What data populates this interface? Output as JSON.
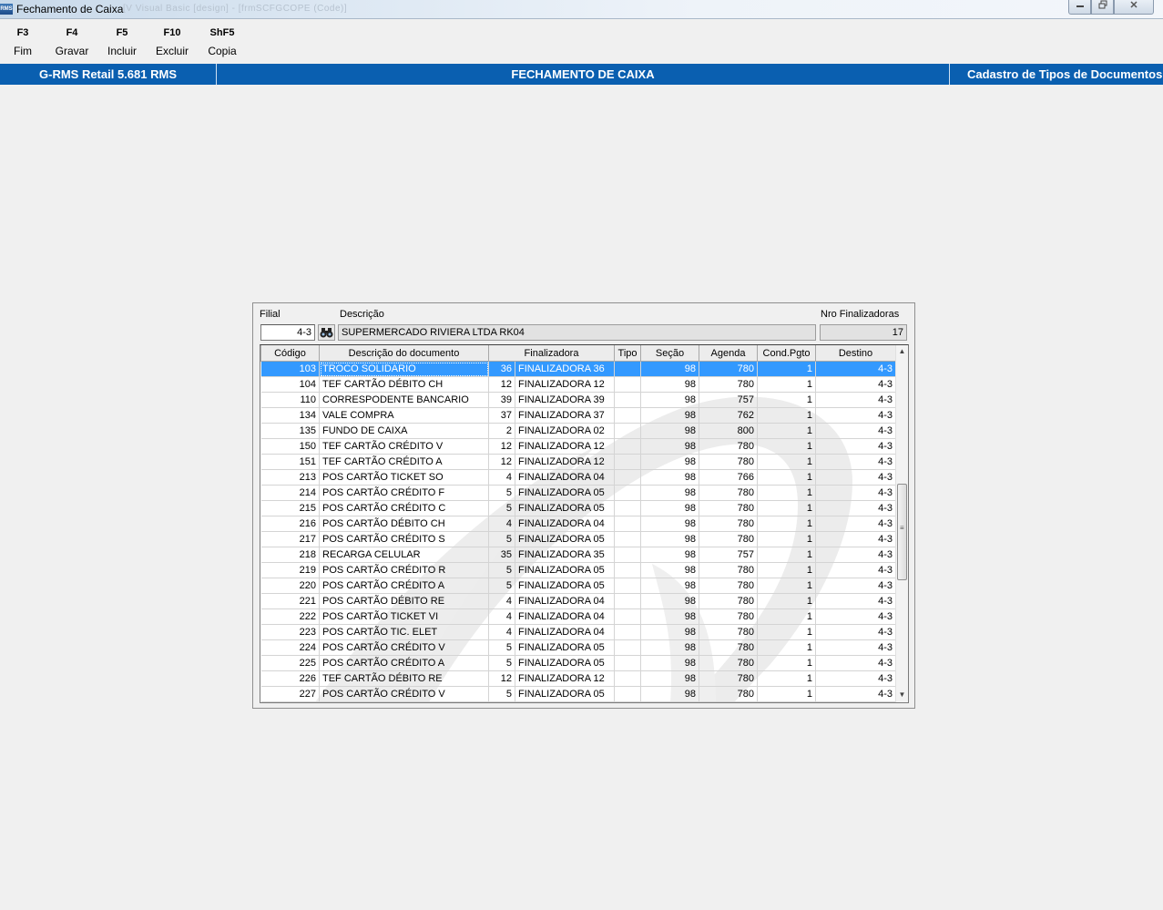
{
  "window": {
    "title": "Fechamento de Caixa",
    "icon_text": "RMS",
    "ghost_title": "[V Visual Basic [design] - [frmSCFGCOPE (Code)]"
  },
  "toolbar": {
    "keys": [
      {
        "key": "F3",
        "label": "Fim"
      },
      {
        "key": "F4",
        "label": "Gravar"
      },
      {
        "key": "F5",
        "label": "Incluir"
      },
      {
        "key": "F10",
        "label": "Excluir"
      },
      {
        "key": "ShF5",
        "label": "Copia"
      }
    ]
  },
  "statusbar": {
    "left": "G-RMS Retail 5.681 RMS",
    "center": "FECHAMENTO DE CAIXA",
    "right": "Cadastro de Tipos de Documentos"
  },
  "form": {
    "filial_label": "Filial",
    "filial_value": "4-3",
    "descricao_label": "Descrição",
    "descricao_value": "SUPERMERCADO RIVIERA LTDA RK04",
    "nro_label": "Nro Finalizadoras",
    "nro_value": "17"
  },
  "grid": {
    "headers": [
      "Código",
      "Descrição do documento",
      "Finalizadora",
      "Tipo",
      "Seção",
      "Agenda",
      "Cond.Pgto",
      "Destino"
    ],
    "selected_index": 0,
    "rows": [
      [
        "103",
        "TROCO SOLIDARIO",
        "36",
        "FINALIZADORA 36",
        "",
        "98",
        "780",
        "1",
        "4-3"
      ],
      [
        "104",
        "TEF CARTÃO DÉBITO CH",
        "12",
        "FINALIZADORA 12",
        "",
        "98",
        "780",
        "1",
        "4-3"
      ],
      [
        "110",
        "CORRESPODENTE BANCARIO",
        "39",
        "FINALIZADORA 39",
        "",
        "98",
        "757",
        "1",
        "4-3"
      ],
      [
        "134",
        "VALE COMPRA",
        "37",
        "FINALIZADORA 37",
        "",
        "98",
        "762",
        "1",
        "4-3"
      ],
      [
        "135",
        "FUNDO DE CAIXA",
        "2",
        "FINALIZADORA 02",
        "",
        "98",
        "800",
        "1",
        "4-3"
      ],
      [
        "150",
        "TEF CARTÃO CRÉDITO V",
        "12",
        "FINALIZADORA 12",
        "",
        "98",
        "780",
        "1",
        "4-3"
      ],
      [
        "151",
        "TEF CARTÃO CRÉDITO A",
        "12",
        "FINALIZADORA 12",
        "",
        "98",
        "780",
        "1",
        "4-3"
      ],
      [
        "213",
        "POS CARTÃO TICKET SO",
        "4",
        "FINALIZADORA 04",
        "",
        "98",
        "766",
        "1",
        "4-3"
      ],
      [
        "214",
        "POS CARTÃO CRÉDITO F",
        "5",
        "FINALIZADORA 05",
        "",
        "98",
        "780",
        "1",
        "4-3"
      ],
      [
        "215",
        "POS CARTÃO CRÉDITO C",
        "5",
        "FINALIZADORA 05",
        "",
        "98",
        "780",
        "1",
        "4-3"
      ],
      [
        "216",
        "POS CARTÃO DÉBITO CH",
        "4",
        "FINALIZADORA 04",
        "",
        "98",
        "780",
        "1",
        "4-3"
      ],
      [
        "217",
        "POS CARTÃO CRÉDITO S",
        "5",
        "FINALIZADORA 05",
        "",
        "98",
        "780",
        "1",
        "4-3"
      ],
      [
        "218",
        "RECARGA CELULAR",
        "35",
        "FINALIZADORA 35",
        "",
        "98",
        "757",
        "1",
        "4-3"
      ],
      [
        "219",
        "POS CARTÃO CRÉDITO R",
        "5",
        "FINALIZADORA 05",
        "",
        "98",
        "780",
        "1",
        "4-3"
      ],
      [
        "220",
        "POS CARTÃO CRÉDITO A",
        "5",
        "FINALIZADORA 05",
        "",
        "98",
        "780",
        "1",
        "4-3"
      ],
      [
        "221",
        "POS CARTÃO DÉBITO RE",
        "4",
        "FINALIZADORA 04",
        "",
        "98",
        "780",
        "1",
        "4-3"
      ],
      [
        "222",
        "POS CARTÃO TICKET VI",
        "4",
        "FINALIZADORA 04",
        "",
        "98",
        "780",
        "1",
        "4-3"
      ],
      [
        "223",
        "POS CARTÃO TIC. ELET",
        "4",
        "FINALIZADORA 04",
        "",
        "98",
        "780",
        "1",
        "4-3"
      ],
      [
        "224",
        "POS CARTÃO CRÉDITO V",
        "5",
        "FINALIZADORA 05",
        "",
        "98",
        "780",
        "1",
        "4-3"
      ],
      [
        "225",
        "POS CARTÃO CRÉDITO A",
        "5",
        "FINALIZADORA 05",
        "",
        "98",
        "780",
        "1",
        "4-3"
      ],
      [
        "226",
        "TEF CARTÃO DÉBITO RE",
        "12",
        "FINALIZADORA 12",
        "",
        "98",
        "780",
        "1",
        "4-3"
      ],
      [
        "227",
        "POS CARTÃO CRÉDITO V",
        "5",
        "FINALIZADORA 05",
        "",
        "98",
        "780",
        "1",
        "4-3"
      ]
    ]
  },
  "icons": {
    "app": "rms-app-icon",
    "find": "binoculars-icon",
    "minimize": "minimize-icon",
    "restore": "restore-icon",
    "close": "close-icon",
    "scroll_up": "scroll-up-arrow-icon",
    "scroll_down": "scroll-down-arrow-icon"
  },
  "colors": {
    "statusbar": "#0a5fb0",
    "selection": "#3399ff",
    "background": "#f0f0f0"
  }
}
